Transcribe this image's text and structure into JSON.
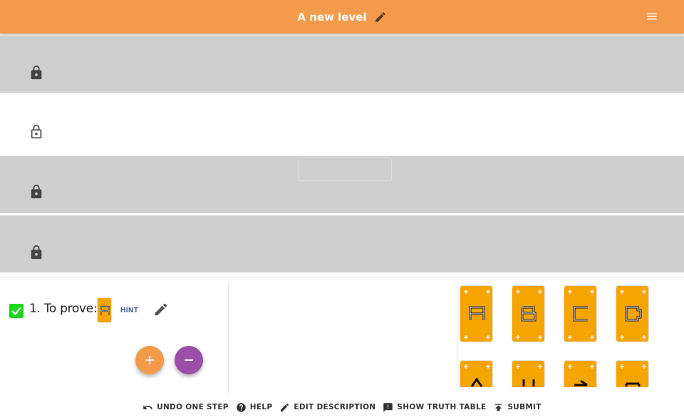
{
  "header": {
    "title": "A new level",
    "edit_icon": "pencil-icon",
    "menu_icon": "hamburger-menu-icon",
    "background_color": "#f39b4b"
  },
  "rows": [
    {
      "state": "locked",
      "icon": "lock-closed-icon"
    },
    {
      "state": "unlocked",
      "icon": "lock-open-icon"
    },
    {
      "state": "locked",
      "icon": "lock-closed-icon"
    },
    {
      "state": "locked",
      "icon": "lock-closed-icon"
    }
  ],
  "step": {
    "checked": true,
    "label": "1. To prove:",
    "goal_card": "A",
    "hint_label": "HINT",
    "edit_icon": "pencil-icon"
  },
  "actions": {
    "add_icon": "plus-icon",
    "remove_icon": "minus-icon",
    "add_color": "#f39b4b",
    "remove_color": "#9b4fa8"
  },
  "palette": {
    "cards": [
      "A",
      "B",
      "C",
      "D",
      "",
      "",
      "",
      ""
    ],
    "card_color": "#f6a400"
  },
  "toolbar": {
    "undo_label": "UNDO ONE STEP",
    "help_label": "HELP",
    "edit_description_label": "EDIT DESCRIPTION",
    "truth_table_label": "SHOW TRUTH TABLE",
    "submit_label": "SUBMIT"
  }
}
